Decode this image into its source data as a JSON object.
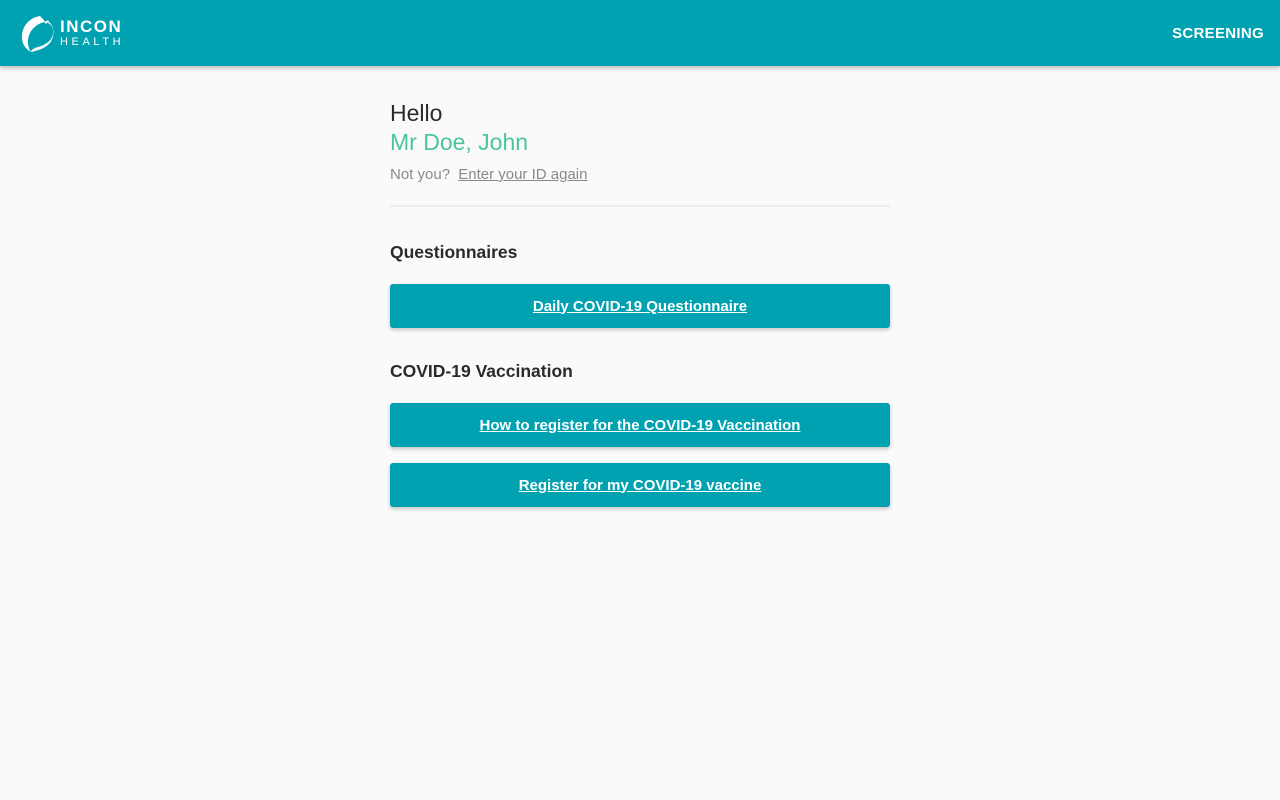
{
  "header": {
    "logo": {
      "line1": "INCON",
      "line2": "HEALTH",
      "icon": "bird-logo-icon"
    },
    "nav_label": "SCREENING"
  },
  "greeting": {
    "hello": "Hello",
    "name": "Mr Doe, John",
    "not_you_text": "Not you?",
    "reenter_link": "Enter your ID again"
  },
  "questionnaires": {
    "title": "Questionnaires",
    "buttons": [
      {
        "label": "Daily COVID-19 Questionnaire"
      }
    ]
  },
  "vaccination": {
    "title": "COVID-19 Vaccination",
    "buttons": [
      {
        "label": "How to register for the COVID-19 Vaccination"
      },
      {
        "label": "Register for my COVID-19 vaccine"
      }
    ]
  },
  "colors": {
    "brand": "#00a1b0",
    "name_accent": "#4cc59a",
    "background": "#fafafa"
  }
}
